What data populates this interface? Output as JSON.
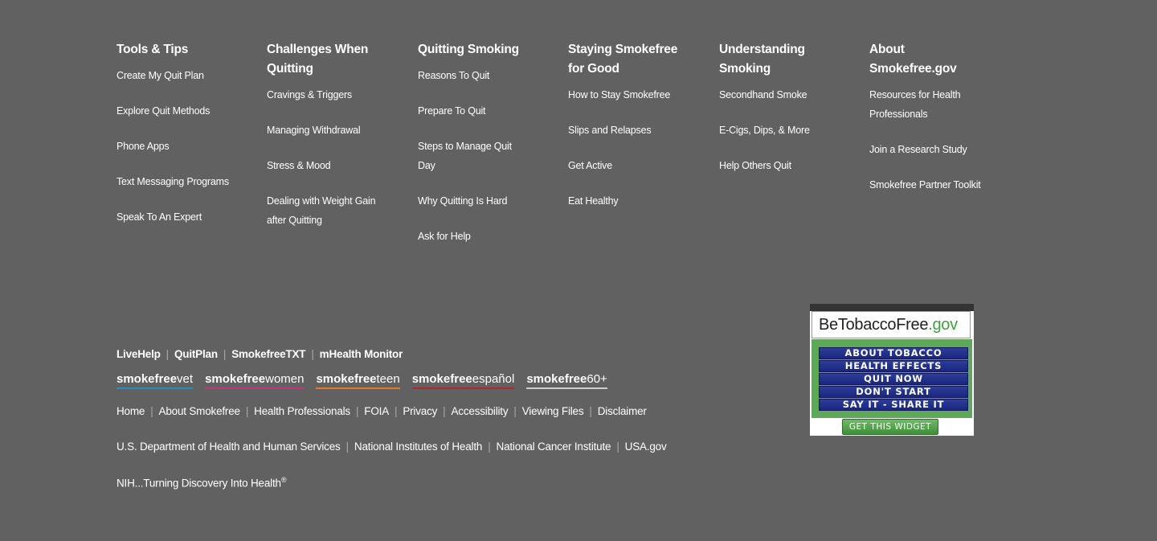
{
  "footer_columns": [
    {
      "title": "Tools & Tips",
      "links": [
        "Create My Quit Plan",
        "Explore Quit Methods",
        "Phone Apps",
        "Text Messaging Programs",
        "Speak To An Expert"
      ]
    },
    {
      "title": "Challenges When Quitting",
      "links": [
        "Cravings & Triggers",
        "Managing Withdrawal",
        "Stress & Mood",
        "Dealing with Weight Gain after Quitting"
      ]
    },
    {
      "title": "Quitting Smoking",
      "links": [
        "Reasons To Quit",
        "Prepare To Quit",
        "Steps to Manage Quit Day",
        "Why Quitting Is Hard",
        "Ask for Help"
      ]
    },
    {
      "title": "Staying Smokefree for Good",
      "links": [
        "How to Stay Smokefree",
        "Slips and Relapses",
        "Get Active",
        "Eat Healthy"
      ]
    },
    {
      "title": "Understanding Smoking",
      "links": [
        "Secondhand Smoke",
        "E-Cigs, Dips, & More",
        "Help Others Quit"
      ]
    },
    {
      "title": "About Smokefree.gov",
      "links": [
        "Resources for Health Professionals",
        "Join a Research Study",
        "Smokefree Partner Toolkit"
      ]
    }
  ],
  "programs": [
    "LiveHelp",
    "QuitPlan",
    "SmokefreeTXT",
    "mHealth Monitor"
  ],
  "separator": "|",
  "brands": [
    {
      "prefix": "smokefree",
      "suffix": "vet",
      "color": "#2a8fb8"
    },
    {
      "prefix": "smokefree",
      "suffix": "women",
      "color": "#c2357d"
    },
    {
      "prefix": "smokefree",
      "suffix": "teen",
      "color": "#e07b26"
    },
    {
      "prefix": "smokefree",
      "suffix": "español",
      "color": "#b3282d"
    },
    {
      "prefix": "smokefree",
      "suffix": "60+",
      "color": "#cccccc"
    }
  ],
  "site_links": [
    "Home",
    "About Smokefree",
    "Health Professionals",
    "FOIA",
    "Privacy",
    "Accessibility",
    "Viewing Files",
    "Disclaimer"
  ],
  "gov_links": [
    "U.S. Department of Health and Human Services",
    "National Institutes of Health",
    "National Cancer Institute",
    "USA.gov"
  ],
  "tagline": {
    "text": "NIH...Turning Discovery Into Health",
    "mark": "®"
  },
  "widget": {
    "logo_main": "BeTobaccoFree",
    "logo_suffix": ".gov",
    "items": [
      "ABOUT TOBACCO",
      "HEALTH EFFECTS",
      "QUIT NOW",
      "DON'T START",
      "SAY IT - SHARE IT"
    ],
    "button": "GET THIS WIDGET"
  }
}
